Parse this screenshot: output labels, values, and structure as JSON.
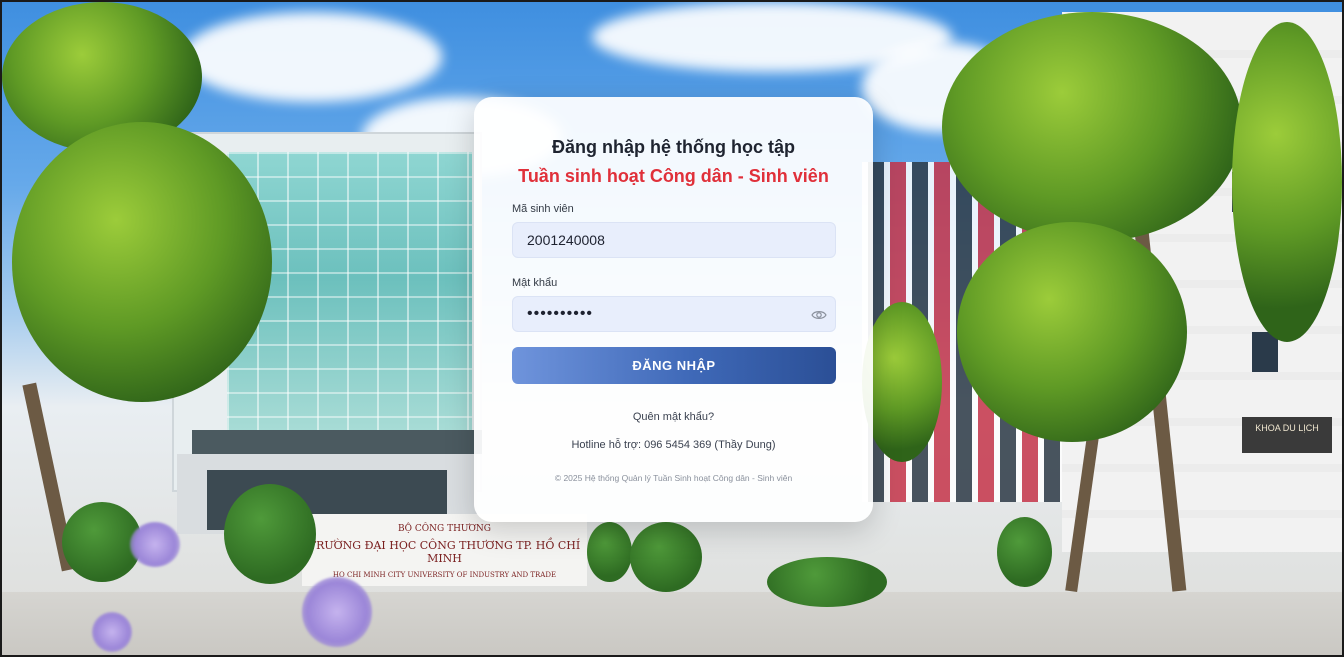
{
  "background": {
    "sign_line1": "BỘ CÔNG THƯƠNG",
    "sign_line2": "TRƯỜNG ĐẠI HỌC CÔNG THƯƠNG TP. HỒ CHÍ MINH",
    "sign_line3": "HO CHI MINH CITY UNIVERSITY OF INDUSTRY AND TRADE",
    "building_sign": "KHOA DU LỊCH"
  },
  "login": {
    "title": "Đăng nhập hệ thống học tập",
    "subtitle": "Tuần sinh hoạt Công dân - Sinh viên",
    "student_id_label": "Mã sinh viên",
    "student_id_value": "2001240008",
    "password_label": "Mật khẩu",
    "password_value": "••••••••••",
    "login_button": "ĐĂNG NHẬP",
    "forgot_password": "Quên mật khẩu?",
    "hotline": "Hotline hỗ trợ: 096 5454 369 (Thầy Dung)",
    "copyright": "© 2025 Hệ thống Quản lý Tuần Sinh hoạt Công dân - Sinh viên"
  },
  "colors": {
    "subtitle_red": "#e0303a",
    "button_blue": "#3f69b8",
    "input_bg": "#e8eefc"
  },
  "icons": {
    "password_toggle": "eye-icon"
  }
}
